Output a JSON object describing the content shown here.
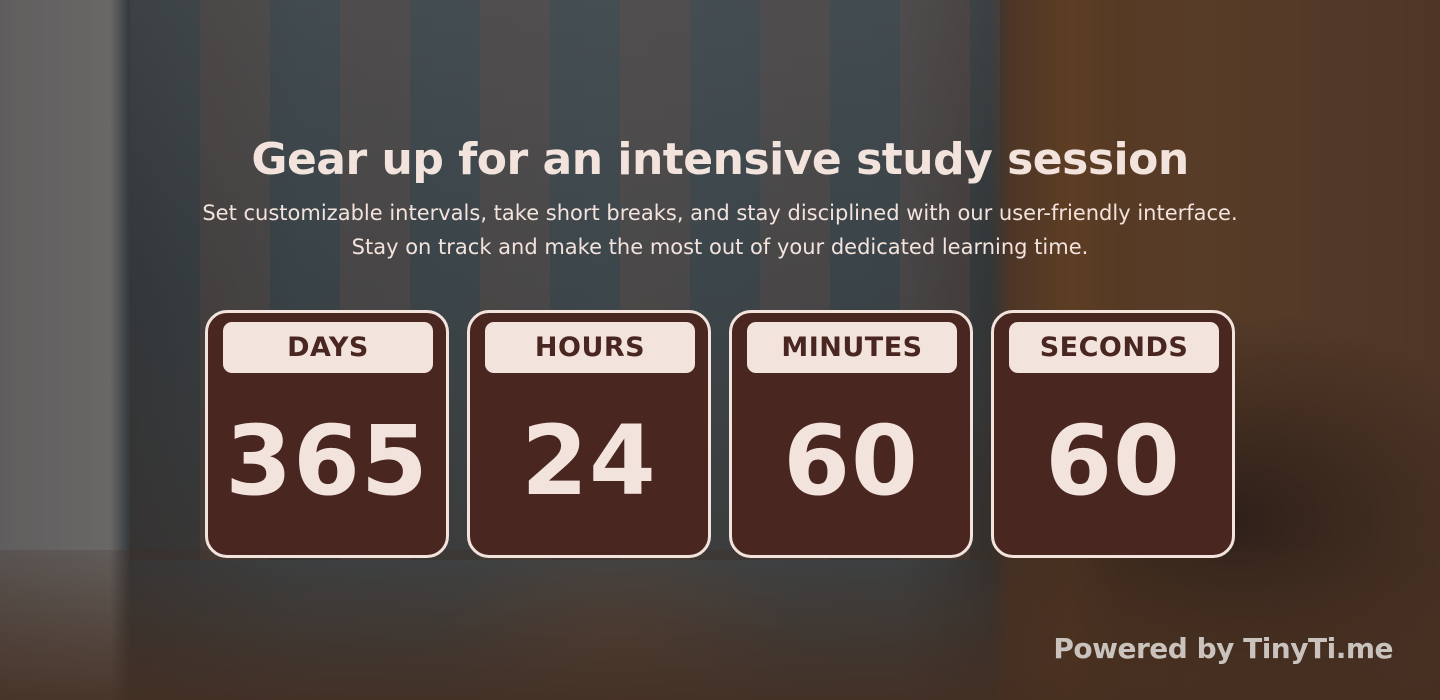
{
  "headline": "Gear up for an intensive study session",
  "subtext": "Set customizable intervals, take short breaks, and stay disciplined with our user-friendly interface. Stay on track and make the most out of your dedicated learning time.",
  "countdown": {
    "days": {
      "label": "DAYS",
      "value": "365"
    },
    "hours": {
      "label": "HOURS",
      "value": "24"
    },
    "minutes": {
      "label": "MINUTES",
      "value": "60"
    },
    "seconds": {
      "label": "SECONDS",
      "value": "60"
    }
  },
  "footer": {
    "powered_by": "Powered by TinyTi.me"
  },
  "colors": {
    "card_background": "#4a2621",
    "card_text": "#f3e3dd",
    "label_background": "#f3e3dd",
    "label_text": "#4a2621",
    "footer_text": "#c9c2bd"
  }
}
